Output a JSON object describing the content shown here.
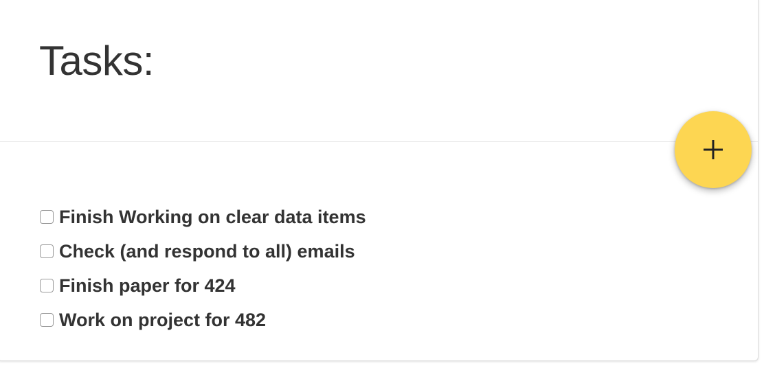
{
  "header": {
    "title": "Tasks:"
  },
  "add_button": {
    "icon": "plus-icon",
    "color": "#fdd652",
    "icon_color": "#222222"
  },
  "tasks": [
    {
      "label": "Finish Working on clear data items",
      "checked": false
    },
    {
      "label": "Check (and respond to all) emails",
      "checked": false
    },
    {
      "label": "Finish paper for 424",
      "checked": false
    },
    {
      "label": "Work on project for 482",
      "checked": false
    }
  ]
}
